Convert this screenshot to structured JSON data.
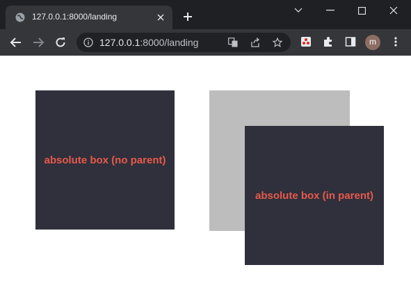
{
  "browser": {
    "tab_title": "127.0.0.1:8000/landing",
    "url_host": "127.0.0.1",
    "url_rest": ":8000/landing",
    "profile_initial": "m"
  },
  "page": {
    "box_no_parent_label": "absolute box (no parent)",
    "box_in_parent_label": "absolute box (in parent)"
  },
  "colors": {
    "box_bg": "#2f303c",
    "box_text": "#e8594a",
    "parent_bg": "#bdbdbd"
  }
}
